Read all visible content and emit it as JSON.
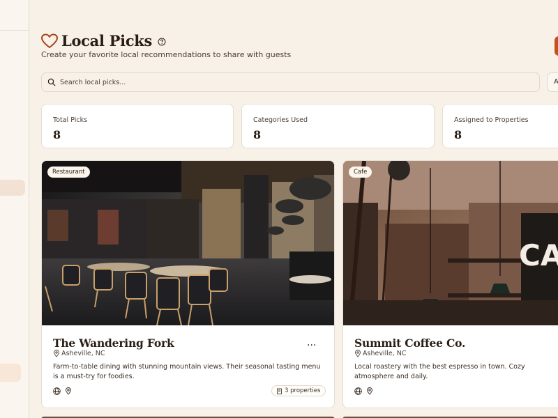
{
  "header": {
    "title": "Local Picks",
    "subtitle": "Create your favorite local recommendations to share with guests"
  },
  "search": {
    "placeholder": "Search local picks..."
  },
  "filter": {
    "label": "A"
  },
  "stats": [
    {
      "label": "Total Picks",
      "value": "8"
    },
    {
      "label": "Categories Used",
      "value": "8"
    },
    {
      "label": "Assigned to Properties",
      "value": "8"
    }
  ],
  "cards": [
    {
      "category": "Restaurant",
      "name": "The Wandering Fork",
      "location": "Asheville, NC",
      "description": "Farm-to-table dining with stunning mountain views. Their seasonal tasting menu is a must-try for foodies.",
      "properties": "3 properties",
      "more": "..."
    },
    {
      "category": "Cafe",
      "name": "Summit Coffee Co.",
      "location": "Asheville, NC",
      "description": "Local roastery with the best espresso in town. Cozy atmosphere and daily."
    }
  ],
  "colors": {
    "accent": "#c1541e",
    "background": "#f8f1e8",
    "card": "#ffffff",
    "text": "#2a1d14"
  },
  "icons": [
    "heart-icon",
    "help-icon",
    "search-icon",
    "pin-icon",
    "globe-icon",
    "map-pin-icon",
    "building-icon",
    "more-icon"
  ]
}
